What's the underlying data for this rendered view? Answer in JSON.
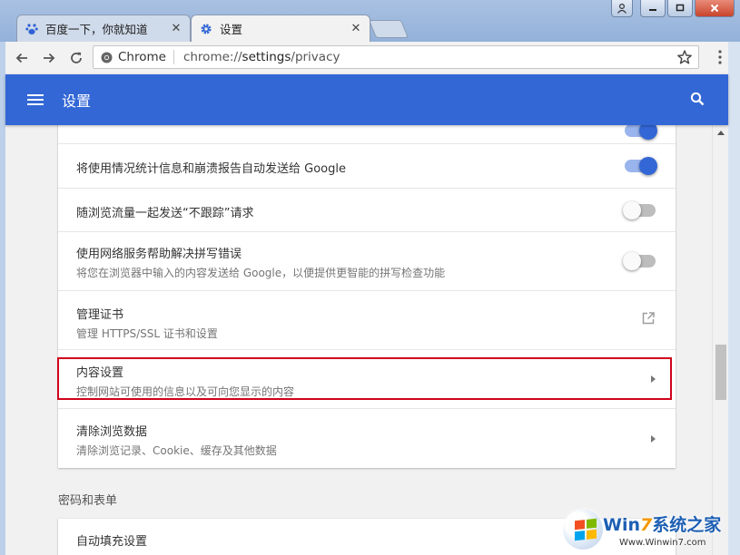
{
  "tabs": [
    {
      "title": "百度一下，你就知道",
      "icon": "baidu-paw-icon",
      "active": false
    },
    {
      "title": "设置",
      "icon": "gear-icon",
      "active": true
    }
  ],
  "omnibox": {
    "chip": "Chrome",
    "url_scheme": "chrome://",
    "url_host": "settings",
    "url_path": "/privacy"
  },
  "header": {
    "title": "设置"
  },
  "privacy_rows": [
    {
      "primary": "将使用情况统计信息和崩溃报告自动发送给 Google",
      "secondary": "",
      "control": "toggle",
      "state": "on"
    },
    {
      "primary": "随浏览流量一起发送“不跟踪”请求",
      "secondary": "",
      "control": "toggle",
      "state": "off"
    },
    {
      "primary": "使用网络服务帮助解决拼写错误",
      "secondary": "将您在浏览器中输入的内容发送给 Google，以便提供更智能的拼写检查功能",
      "control": "toggle",
      "state": "off"
    },
    {
      "primary": "管理证书",
      "secondary": "管理 HTTPS/SSL 证书和设置",
      "control": "external-link-icon"
    },
    {
      "primary": "内容设置",
      "secondary": "控制网站可使用的信息以及可向您显示的内容",
      "control": "chevron-right-icon"
    },
    {
      "primary": "清除浏览数据",
      "secondary": "清除浏览记录、Cookie、缓存及其他数据",
      "control": "chevron-right-icon"
    }
  ],
  "passwords_section": {
    "title": "密码和表单",
    "rows": [
      {
        "primary": "自动填充设置"
      }
    ]
  },
  "watermark": {
    "brand_prefix": "Win",
    "brand_seven": "7",
    "brand_suffix": "系统之家",
    "url": "Www.Winwin7.com"
  },
  "colors": {
    "header_blue": "#3367d6",
    "toggle_on": "#3367d6",
    "highlight_red": "#d0021b"
  }
}
